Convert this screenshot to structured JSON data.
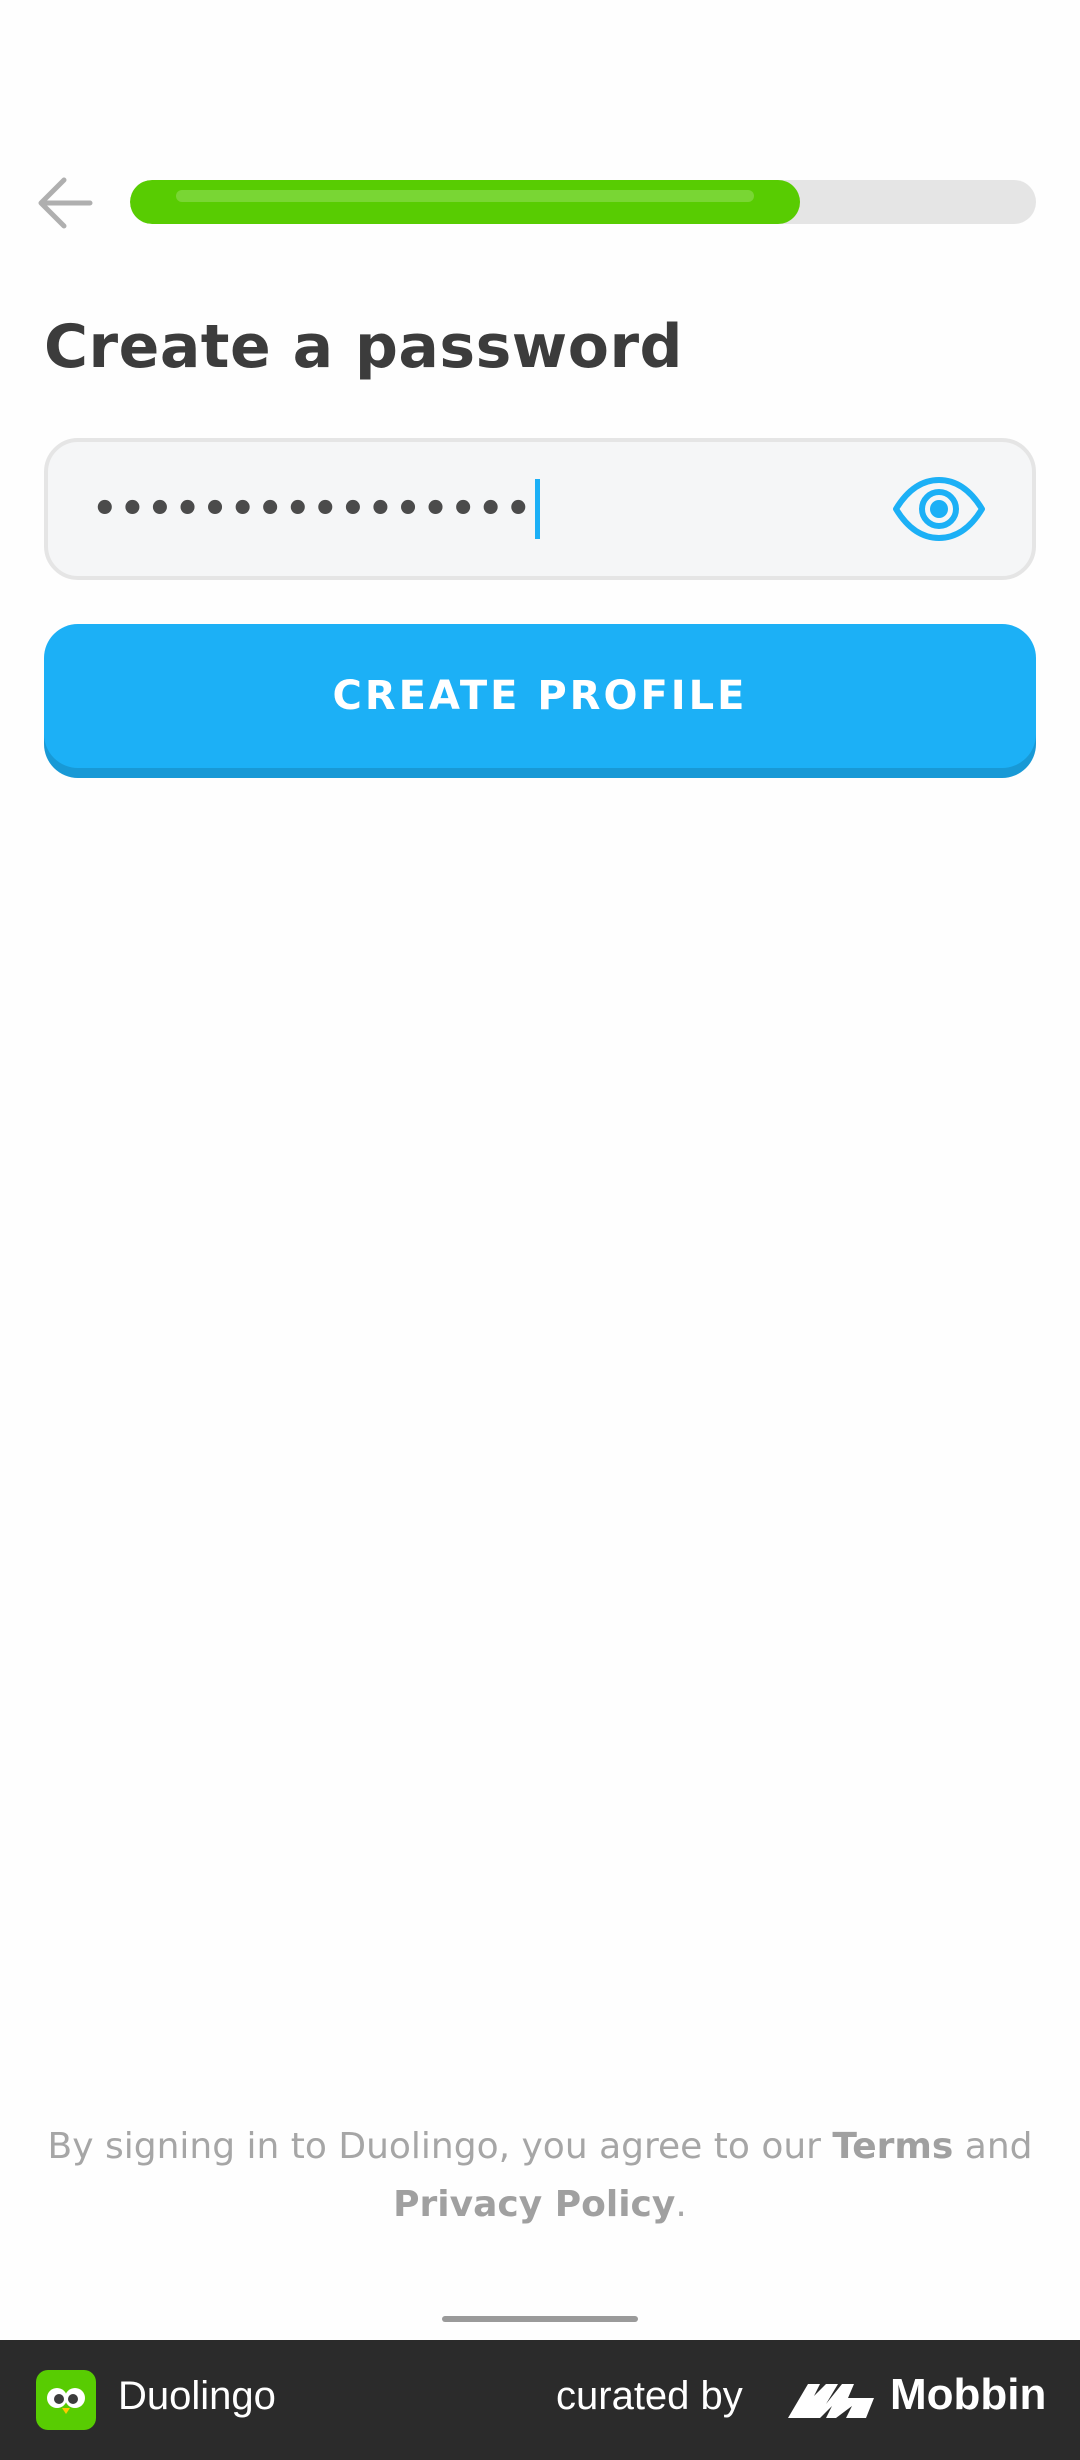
{
  "header": {
    "back_icon": "arrow-left-icon",
    "progress": 0.74
  },
  "page": {
    "title": "Create a password"
  },
  "password_field": {
    "masked_value": "••••••••••••••••",
    "toggle_icon": "eye-icon"
  },
  "actions": {
    "create_profile_label": "CREATE PROFILE"
  },
  "legal": {
    "prefix": "By signing in to Duolingo, you agree to our ",
    "terms_label": "Terms",
    "middle": " and",
    "privacy_label": "Privacy Policy",
    "suffix": "."
  },
  "footer": {
    "app_name": "Duolingo",
    "curated_by": "curated by",
    "brand": "Mobbin"
  },
  "colors": {
    "accent_blue": "#1cb0f6",
    "progress_green": "#58cc02",
    "title_text": "#3c3c3c"
  }
}
